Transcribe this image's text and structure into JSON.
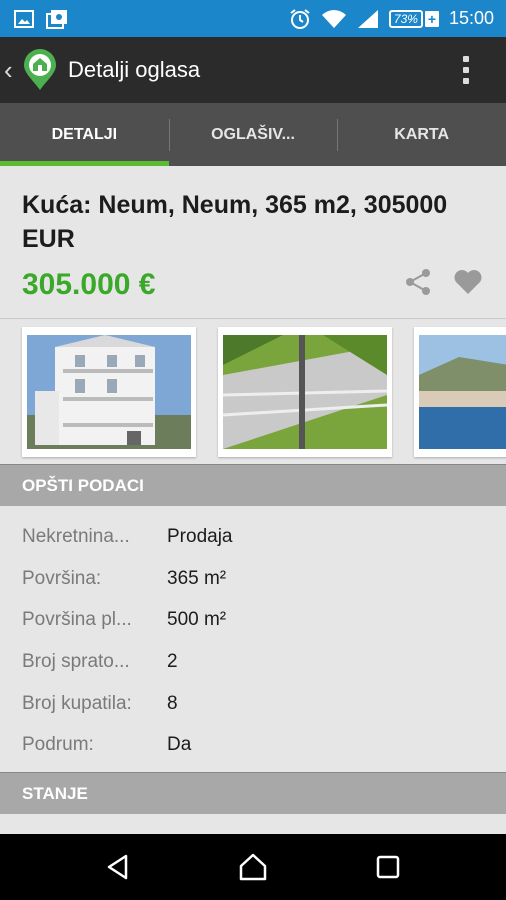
{
  "status_bar": {
    "battery_percent": "73%",
    "time": "15:00",
    "icons": [
      "image-icon",
      "photo-album-icon",
      "alarm-icon",
      "wifi-icon",
      "signal-icon",
      "battery-icon"
    ]
  },
  "app_bar": {
    "title": "Detalji oglasa",
    "brand_color": "#4caf50"
  },
  "tabs": [
    {
      "label": "DETALJI",
      "active": true
    },
    {
      "label": "OGLAŠIV...",
      "active": false
    },
    {
      "label": "KARTA",
      "active": false
    }
  ],
  "listing": {
    "title": "Kuća: Neum, Neum, 365 m2, 305000 EUR",
    "price": "305.000 €",
    "price_color": "#3aa828"
  },
  "sections": {
    "general": "OPŠTI PODACI",
    "condition": "STANJE"
  },
  "details": [
    {
      "label": "Nekretnina...",
      "value": "Prodaja"
    },
    {
      "label": "Površina:",
      "value": "365 m²"
    },
    {
      "label": "Površina pl...",
      "value": "500 m²"
    },
    {
      "label": "Broj sprato...",
      "value": "2"
    },
    {
      "label": "Broj kupatila:",
      "value": "8"
    },
    {
      "label": "Podrum:",
      "value": "Da"
    }
  ],
  "accent_color": "#5dbb33"
}
